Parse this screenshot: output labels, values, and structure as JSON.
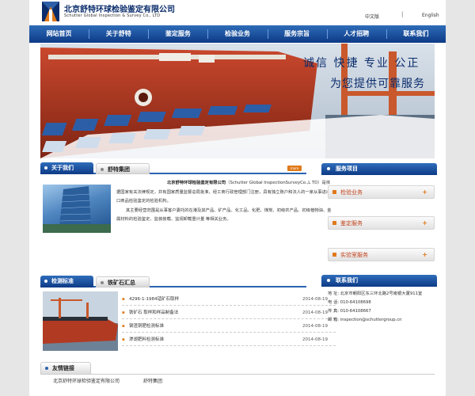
{
  "header": {
    "company_cn": "北京舒特环球检验鉴定有限公司",
    "company_en": "Schutter Global Inspection & Survey Co., LTD",
    "lang_cn": "中文版",
    "lang_sep": "|",
    "lang_en": "English"
  },
  "nav": [
    "网站首页",
    "关于舒特",
    "鉴定服务",
    "检验业务",
    "服务宗旨",
    "人才招聘",
    "联系我们"
  ],
  "banner": {
    "slogan1": "诚信 快捷 专业 公正",
    "slogan2": "为您提供可靠服务"
  },
  "about": {
    "tab_active": "关于我们",
    "tab_inactive": "舒特集团",
    "more": "more",
    "company_bold": "北京舒特环球检验鉴定有限公司",
    "para1": "（Schutter Global InspectionSurveyCo.,L TD）是依据国家有关法律规定，并有国家质量监督总局批准，经工商行政管理部门注册，具有独立账户和法人的一家从事进出口商品检验鉴定的检验机构。",
    "para2": "其主要经营范围是从事客户委托的在港及其产品、矿产品、化工品、化肥、煤炭、初级农产品、初级植物油、金属材料的检验鉴定、监装装载、监视卸载重计量 等相关业务。"
  },
  "standards": {
    "tab_active": "检测标准",
    "tab_inactive": "铁矿石汇总",
    "items": [
      {
        "title": "4296-1-1984锰矿石取样",
        "date": "2014-08-19"
      },
      {
        "title": "铁矿石 取样和样品制备法",
        "date": "2014-08-19"
      },
      {
        "title": "钢渣铜肥检测标准",
        "date": "2014-08-19"
      },
      {
        "title": "渗滤肥料检测标准",
        "date": "2014-08-19"
      }
    ]
  },
  "services": {
    "title": "服务项目",
    "items": [
      "检验业务",
      "鉴定服务",
      "实验室服务"
    ]
  },
  "contact": {
    "title": "联系我们",
    "address": "地 址: 北京市朝阳区东三环北路2号南银大厦911室",
    "phone": "电 话: 010-64108698",
    "fax": "传 真: 010-64108667",
    "email": "邮 箱: inspection@schuttergroup.cn"
  },
  "links": {
    "title": "友情链接",
    "items": [
      "北京舒特环球检验鉴定有限公司",
      "舒特集团"
    ]
  },
  "colors": {
    "nav_blue": "#0d3a86",
    "accent_orange": "#e07a1b",
    "hull_red": "#b13a23"
  }
}
